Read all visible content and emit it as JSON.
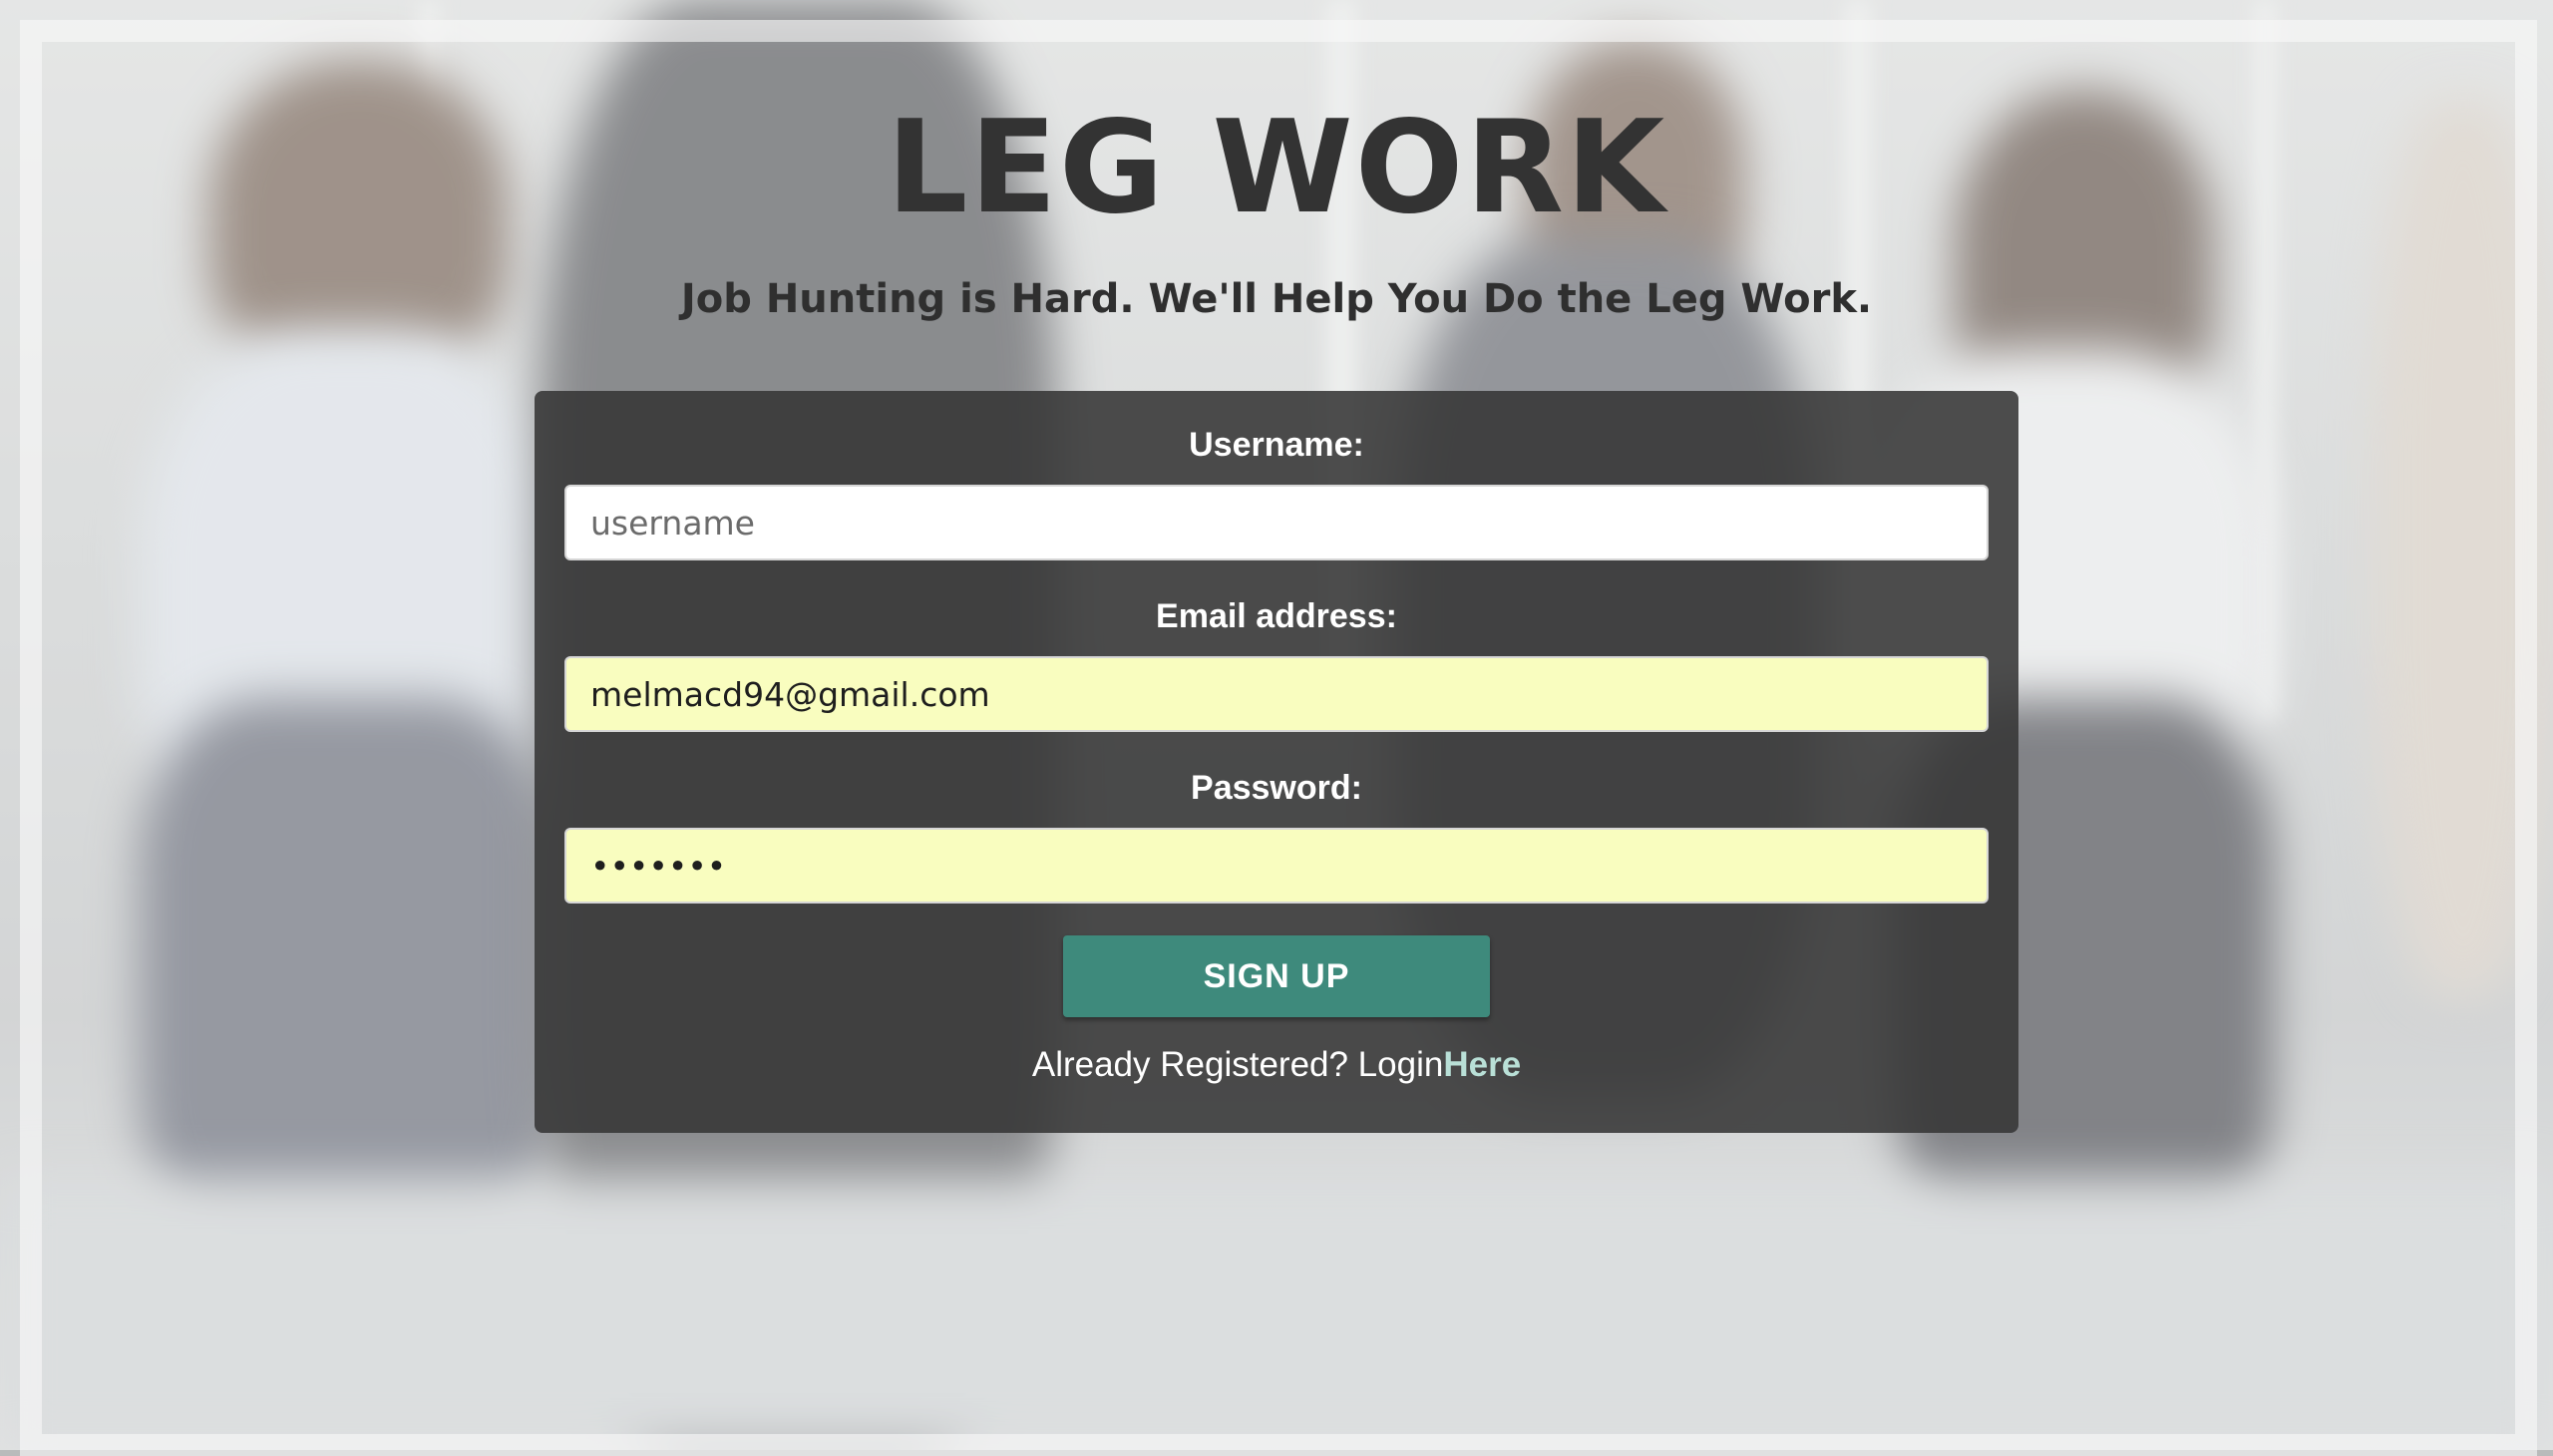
{
  "header": {
    "title": "LEG WORK",
    "subtitle": "Job Hunting is Hard. We'll Help You Do the Leg Work."
  },
  "form": {
    "username": {
      "label": "Username:",
      "placeholder": "username",
      "value": ""
    },
    "email": {
      "label": "Email address:",
      "value": "melmacd94@gmail.com"
    },
    "password": {
      "label": "Password:",
      "value": "•••••••"
    },
    "submit_label": "SIGN UP",
    "login_prompt": "Already Registered? Login",
    "login_link": "Here"
  },
  "colors": {
    "accent": "#3e8a7c",
    "link": "#b9e0d7",
    "card": "#363636",
    "autofill": "#f9fdbf"
  }
}
